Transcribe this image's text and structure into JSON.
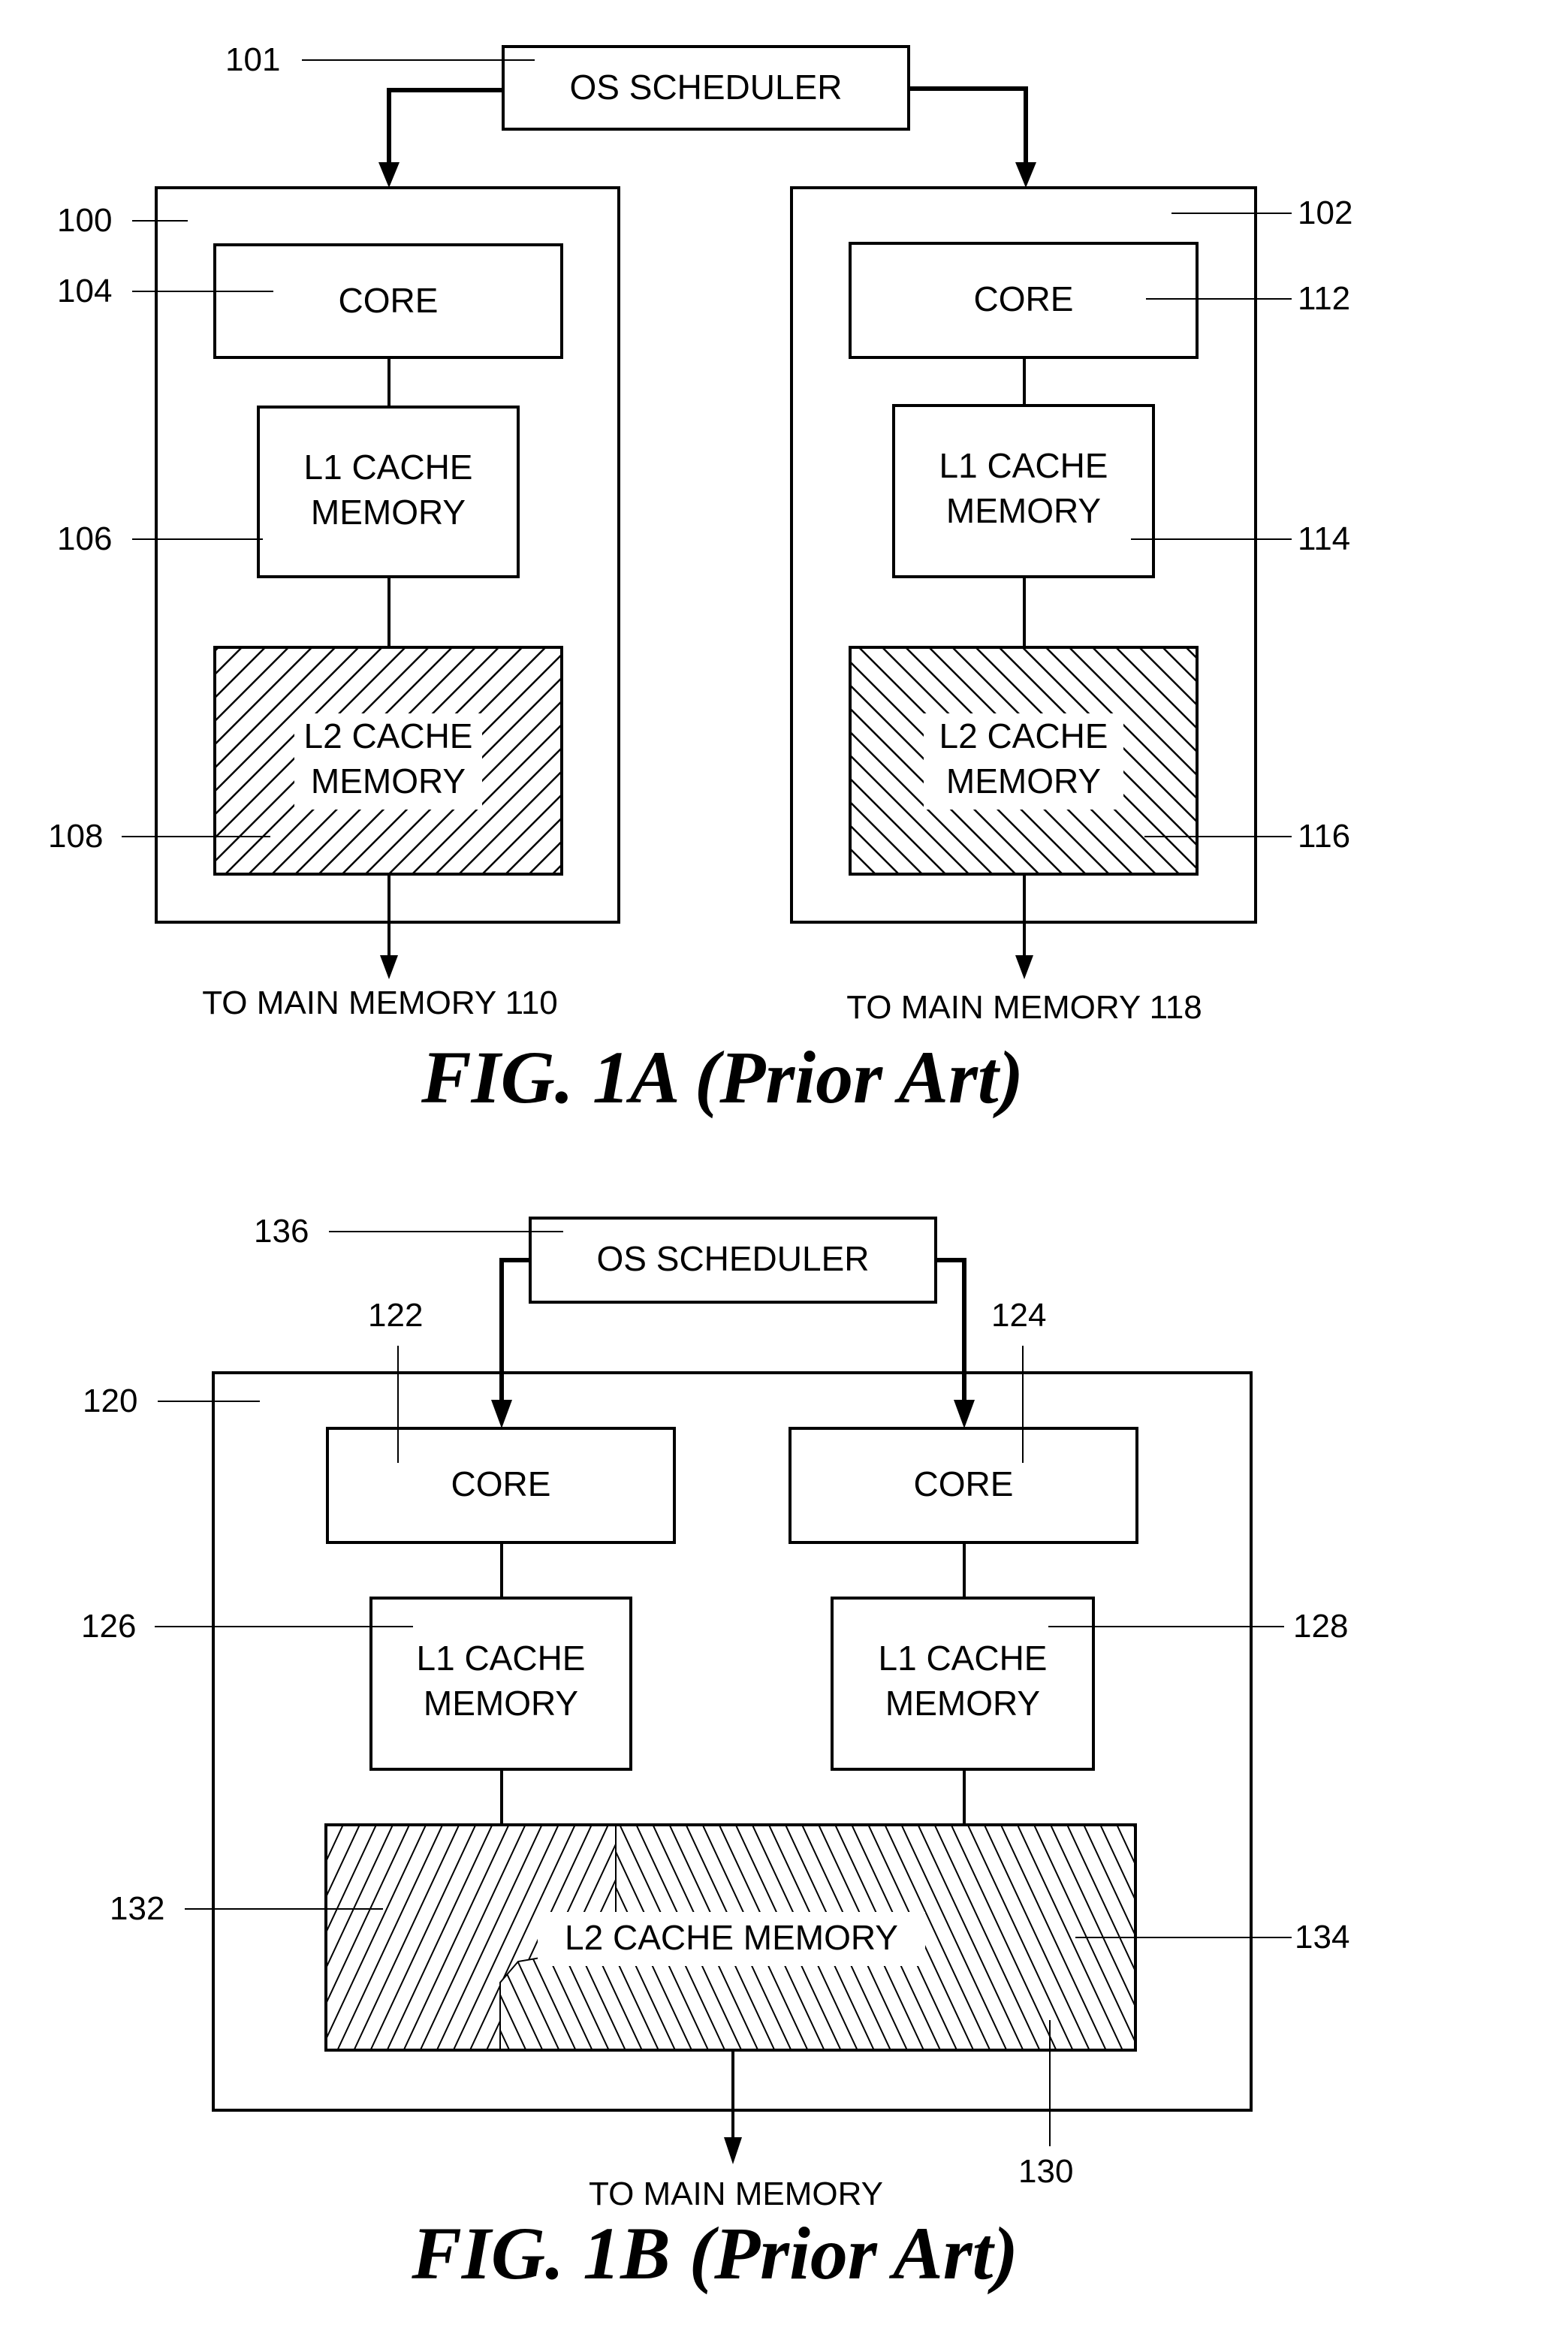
{
  "figures": {
    "fig1a": {
      "caption": "FIG. 1A (Prior Art)",
      "scheduler": {
        "label": "OS SCHEDULER",
        "ref": "101"
      },
      "processors": [
        {
          "ref": "100",
          "core": {
            "label": "CORE",
            "ref": "104"
          },
          "l1": {
            "line1": "L1 CACHE",
            "line2": "MEMORY",
            "ref": "106"
          },
          "l2": {
            "line1": "L2 CACHE",
            "line2": "MEMORY",
            "ref": "108",
            "hatch": "forward-diagonal"
          },
          "output": "TO MAIN MEMORY 110"
        },
        {
          "ref": "102",
          "core": {
            "label": "CORE",
            "ref": "112"
          },
          "l1": {
            "line1": "L1 CACHE",
            "line2": "MEMORY",
            "ref": "114"
          },
          "l2": {
            "line1": "L2 CACHE",
            "line2": "MEMORY",
            "ref": "116",
            "hatch": "backward-diagonal"
          },
          "output": "TO MAIN MEMORY 118"
        }
      ]
    },
    "fig1b": {
      "caption": "FIG. 1B (Prior Art)",
      "scheduler": {
        "label": "OS SCHEDULER",
        "ref": "136"
      },
      "processor_ref": "120",
      "cores": [
        {
          "label": "CORE",
          "ref": "122"
        },
        {
          "label": "CORE",
          "ref": "124"
        }
      ],
      "l1": [
        {
          "line1": "L1 CACHE",
          "line2": "MEMORY",
          "ref": "126"
        },
        {
          "line1": "L1 CACHE",
          "line2": "MEMORY",
          "ref": "128"
        }
      ],
      "l2": {
        "label": "L2 CACHE MEMORY",
        "ref": "130",
        "partitions": [
          {
            "ref": "132",
            "hatch": "forward-diagonal"
          },
          {
            "ref": "134",
            "hatch": "backward-diagonal"
          }
        ]
      },
      "output": "TO MAIN MEMORY"
    }
  }
}
